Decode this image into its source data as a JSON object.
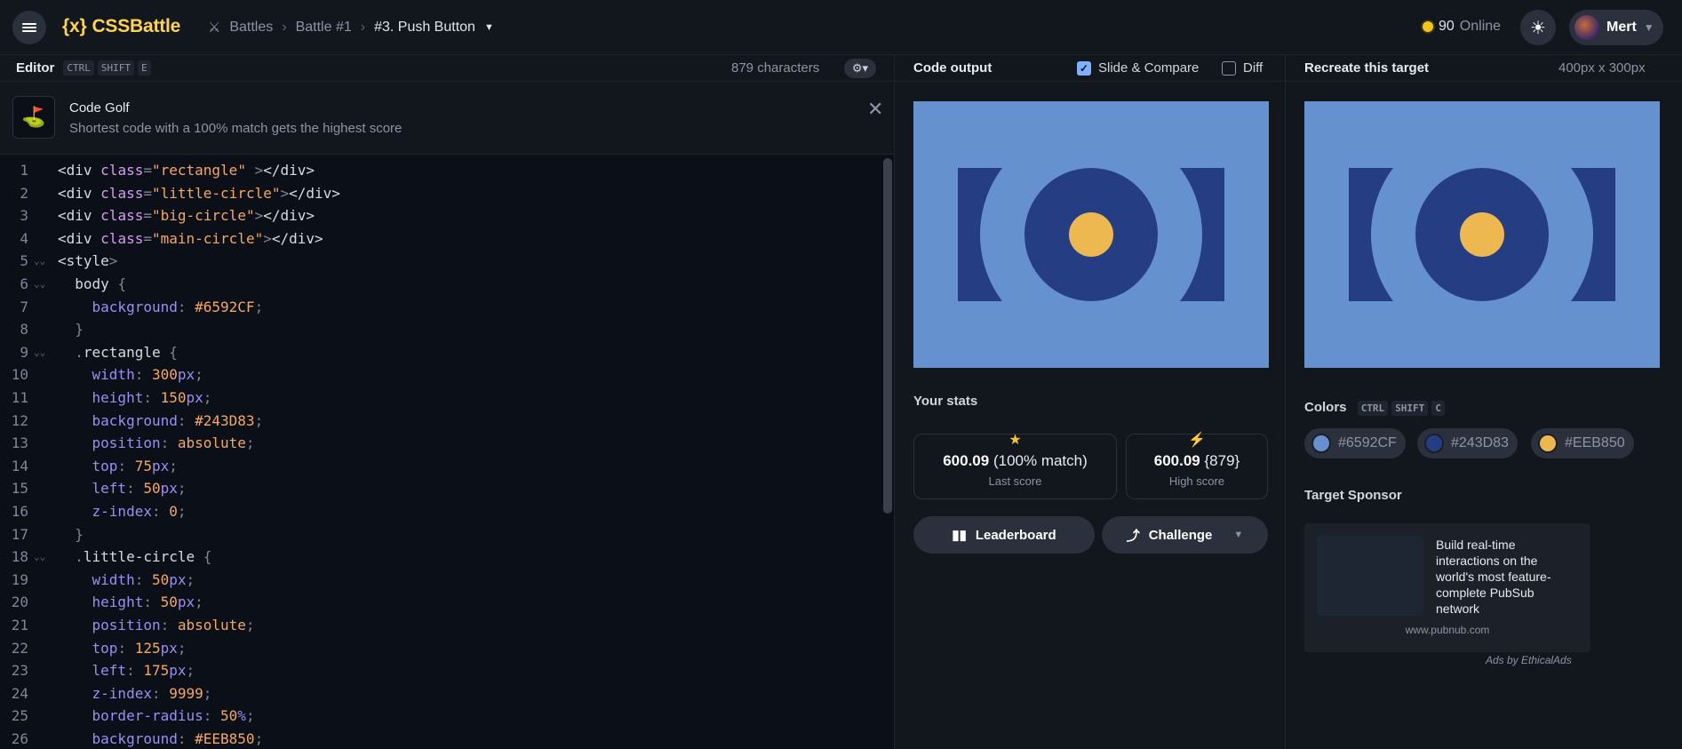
{
  "topbar": {
    "logo": "CSSBattle",
    "logo_mark": "{x}",
    "breadcrumbs": [
      "Battles",
      "Battle #1",
      "#3. Push Button"
    ],
    "online_count": "90",
    "online_label": "Online",
    "user_name": "Mert"
  },
  "editor": {
    "title": "Editor",
    "shortcut": [
      "CTRL",
      "SHIFT",
      "E"
    ],
    "char_count": "879 characters",
    "golf_title": "Code Golf",
    "golf_desc": "Shortest code with a 100% match gets the highest score",
    "lines": [
      {
        "n": "1",
        "fold": false,
        "tokens": [
          [
            "tag",
            "<div "
          ],
          [
            "attr",
            "class"
          ],
          [
            "punc",
            "="
          ],
          [
            "str",
            "\"rectangle\""
          ],
          [
            "punc",
            " >"
          ],
          [
            "tag",
            "</div>"
          ]
        ]
      },
      {
        "n": "2",
        "fold": false,
        "tokens": [
          [
            "tag",
            "<div "
          ],
          [
            "attr",
            "class"
          ],
          [
            "punc",
            "="
          ],
          [
            "str",
            "\"little-circle\""
          ],
          [
            "punc",
            ">"
          ],
          [
            "tag",
            "</div>"
          ]
        ]
      },
      {
        "n": "3",
        "fold": false,
        "tokens": [
          [
            "tag",
            "<div "
          ],
          [
            "attr",
            "class"
          ],
          [
            "punc",
            "="
          ],
          [
            "str",
            "\"big-circle\""
          ],
          [
            "punc",
            ">"
          ],
          [
            "tag",
            "</div>"
          ]
        ]
      },
      {
        "n": "4",
        "fold": false,
        "tokens": [
          [
            "tag",
            "<div "
          ],
          [
            "attr",
            "class"
          ],
          [
            "punc",
            "="
          ],
          [
            "str",
            "\"main-circle\""
          ],
          [
            "punc",
            ">"
          ],
          [
            "tag",
            "</div>"
          ]
        ]
      },
      {
        "n": "5",
        "fold": true,
        "tokens": [
          [
            "tag",
            "<style"
          ],
          [
            "punc",
            ">"
          ]
        ]
      },
      {
        "n": "6",
        "fold": true,
        "tokens": [
          [
            "sel",
            "  body "
          ],
          [
            "punc",
            "{"
          ]
        ]
      },
      {
        "n": "7",
        "fold": false,
        "tokens": [
          [
            "prop",
            "    background"
          ],
          [
            "punc",
            ": "
          ],
          [
            "val",
            "#6592CF"
          ],
          [
            "punc",
            ";"
          ]
        ]
      },
      {
        "n": "8",
        "fold": false,
        "tokens": [
          [
            "punc",
            "  }"
          ]
        ]
      },
      {
        "n": "9",
        "fold": true,
        "tokens": [
          [
            "punc",
            "  ."
          ],
          [
            "sel",
            "rectangle "
          ],
          [
            "punc",
            "{"
          ]
        ]
      },
      {
        "n": "10",
        "fold": false,
        "tokens": [
          [
            "prop",
            "    width"
          ],
          [
            "punc",
            ": "
          ],
          [
            "num",
            "300"
          ],
          [
            "prop",
            "px"
          ],
          [
            "punc",
            ";"
          ]
        ]
      },
      {
        "n": "11",
        "fold": false,
        "tokens": [
          [
            "prop",
            "    height"
          ],
          [
            "punc",
            ": "
          ],
          [
            "num",
            "150"
          ],
          [
            "prop",
            "px"
          ],
          [
            "punc",
            ";"
          ]
        ]
      },
      {
        "n": "12",
        "fold": false,
        "tokens": [
          [
            "prop",
            "    background"
          ],
          [
            "punc",
            ": "
          ],
          [
            "val",
            "#243D83"
          ],
          [
            "punc",
            ";"
          ]
        ]
      },
      {
        "n": "13",
        "fold": false,
        "tokens": [
          [
            "prop",
            "    position"
          ],
          [
            "punc",
            ": "
          ],
          [
            "val",
            "absolute"
          ],
          [
            "punc",
            ";"
          ]
        ]
      },
      {
        "n": "14",
        "fold": false,
        "tokens": [
          [
            "prop",
            "    top"
          ],
          [
            "punc",
            ": "
          ],
          [
            "num",
            "75"
          ],
          [
            "prop",
            "px"
          ],
          [
            "punc",
            ";"
          ]
        ]
      },
      {
        "n": "15",
        "fold": false,
        "tokens": [
          [
            "prop",
            "    left"
          ],
          [
            "punc",
            ": "
          ],
          [
            "num",
            "50"
          ],
          [
            "prop",
            "px"
          ],
          [
            "punc",
            ";"
          ]
        ]
      },
      {
        "n": "16",
        "fold": false,
        "tokens": [
          [
            "prop",
            "    z-index"
          ],
          [
            "punc",
            ": "
          ],
          [
            "num",
            "0"
          ],
          [
            "punc",
            ";"
          ]
        ]
      },
      {
        "n": "17",
        "fold": false,
        "tokens": [
          [
            "punc",
            "  }"
          ]
        ]
      },
      {
        "n": "18",
        "fold": true,
        "tokens": [
          [
            "punc",
            "  ."
          ],
          [
            "sel",
            "little-circle "
          ],
          [
            "punc",
            "{"
          ]
        ]
      },
      {
        "n": "19",
        "fold": false,
        "tokens": [
          [
            "prop",
            "    width"
          ],
          [
            "punc",
            ": "
          ],
          [
            "num",
            "50"
          ],
          [
            "prop",
            "px"
          ],
          [
            "punc",
            ";"
          ]
        ]
      },
      {
        "n": "20",
        "fold": false,
        "tokens": [
          [
            "prop",
            "    height"
          ],
          [
            "punc",
            ": "
          ],
          [
            "num",
            "50"
          ],
          [
            "prop",
            "px"
          ],
          [
            "punc",
            ";"
          ]
        ]
      },
      {
        "n": "21",
        "fold": false,
        "tokens": [
          [
            "prop",
            "    position"
          ],
          [
            "punc",
            ": "
          ],
          [
            "val",
            "absolute"
          ],
          [
            "punc",
            ";"
          ]
        ]
      },
      {
        "n": "22",
        "fold": false,
        "tokens": [
          [
            "prop",
            "    top"
          ],
          [
            "punc",
            ": "
          ],
          [
            "num",
            "125"
          ],
          [
            "prop",
            "px"
          ],
          [
            "punc",
            ";"
          ]
        ]
      },
      {
        "n": "23",
        "fold": false,
        "tokens": [
          [
            "prop",
            "    left"
          ],
          [
            "punc",
            ": "
          ],
          [
            "num",
            "175"
          ],
          [
            "prop",
            "px"
          ],
          [
            "punc",
            ";"
          ]
        ]
      },
      {
        "n": "24",
        "fold": false,
        "tokens": [
          [
            "prop",
            "    z-index"
          ],
          [
            "punc",
            ": "
          ],
          [
            "num",
            "9999"
          ],
          [
            "punc",
            ";"
          ]
        ]
      },
      {
        "n": "25",
        "fold": false,
        "tokens": [
          [
            "prop",
            "    border-radius"
          ],
          [
            "punc",
            ": "
          ],
          [
            "num",
            "50"
          ],
          [
            "prop",
            "%"
          ],
          [
            "punc",
            ";"
          ]
        ]
      },
      {
        "n": "26",
        "fold": false,
        "tokens": [
          [
            "prop",
            "    background"
          ],
          [
            "punc",
            ": "
          ],
          [
            "val",
            "#EEB850"
          ],
          [
            "punc",
            ";"
          ]
        ]
      }
    ]
  },
  "output": {
    "title": "Code output",
    "slide_compare_label": "Slide & Compare",
    "slide_compare_checked": true,
    "diff_label": "Diff",
    "diff_checked": false,
    "stats_title": "Your stats",
    "last_score": "600.09",
    "last_match": "(100% match)",
    "last_label": "Last score",
    "high_score": "600.09",
    "high_chars": "{879}",
    "high_label": "High score",
    "leaderboard_label": "Leaderboard",
    "challenge_label": "Challenge"
  },
  "target": {
    "title": "Recreate this target",
    "size": "400px x 300px",
    "colors_title": "Colors",
    "colors_shortcut": [
      "CTRL",
      "SHIFT",
      "C"
    ],
    "colors": [
      "#6592CF",
      "#243D83",
      "#EEB850"
    ],
    "sponsor_title": "Target Sponsor",
    "ad_text": "Build real-time interactions on the world's most feature-complete PubSub network",
    "ad_url": "www.pubnub.com",
    "ads_by": "Ads by EthicalAds"
  },
  "palette": {
    "bg": "#6592CF",
    "dark": "#243D83",
    "accent": "#EEB850"
  }
}
